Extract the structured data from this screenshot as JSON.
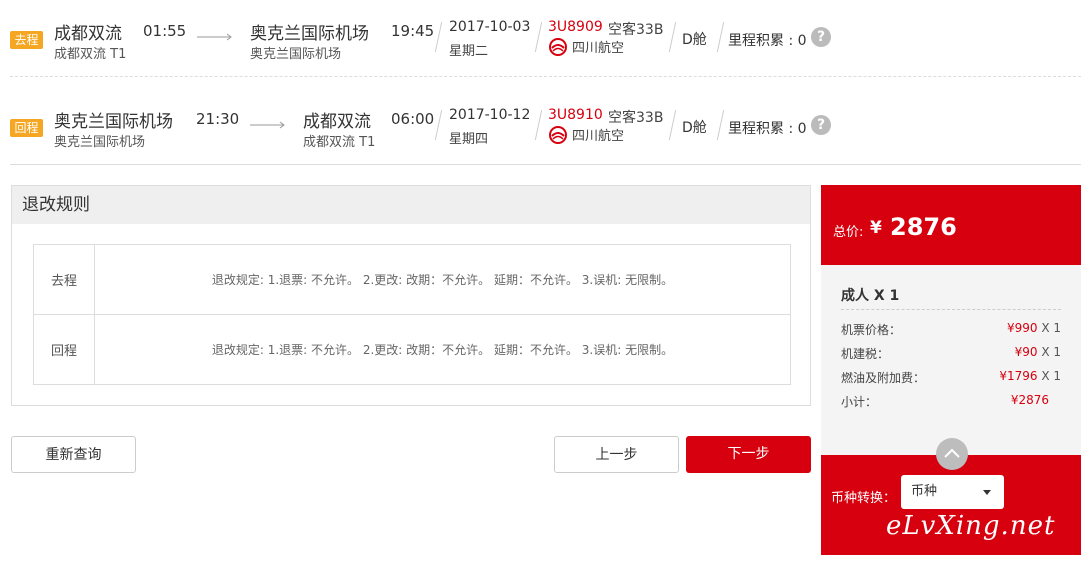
{
  "outbound": {
    "tag": "去程",
    "dep_city": "成都双流",
    "dep_time": "01:55",
    "dep_airport": "成都双流 T1",
    "arr_city": "奥克兰国际机场",
    "arr_time": "19:45",
    "arr_airport": "奥克兰国际机场",
    "date": "2017-10-03",
    "weekday": "星期二",
    "flight_no": "3U8909",
    "plane": "空客33B",
    "airline": "四川航空",
    "cabin": "D舱",
    "points": "里程积累 : 0"
  },
  "return": {
    "tag": "回程",
    "dep_city": "奥克兰国际机场",
    "dep_time": "21:30",
    "dep_airport": "奥克兰国际机场",
    "arr_city": "成都双流",
    "arr_time": "06:00",
    "arr_airport": "成都双流 T1",
    "date": "2017-10-12",
    "weekday": "星期四",
    "flight_no": "3U8910",
    "plane": "空客33B",
    "airline": "四川航空",
    "cabin": "D舱",
    "points": "里程积累 : 0"
  },
  "rules": {
    "title": "退改规则",
    "rows": [
      {
        "label": "去程",
        "text": "退改规定: 1.退票: 不允许。 2.更改: 改期：不允许。 延期：不允许。 3.误机: 无限制。"
      },
      {
        "label": "回程",
        "text": "退改规定: 1.退票: 不允许。 2.更改: 改期：不允许。 延期：不允许。 3.误机: 无限制。"
      }
    ]
  },
  "buttons": {
    "requery": "重新查询",
    "prev": "上一步",
    "next": "下一步"
  },
  "price": {
    "total_label": "总价:",
    "currency": "¥",
    "total": "2876",
    "adult": "成人 X 1",
    "lines": [
      {
        "label": "机票价格：",
        "value": "¥990",
        "mult": " X 1"
      },
      {
        "label": "机建税：",
        "value": "¥90",
        "mult": " X 1"
      },
      {
        "label": "燃油及附加费：",
        "value": "¥1796",
        "mult": " X 1"
      },
      {
        "label": "小计：",
        "value": "¥2876",
        "mult": ""
      }
    ],
    "currency_convert_label": "币种转换：",
    "currency_select": "币种",
    "watermark": "eLvXing.net"
  },
  "colors": {
    "accent": "#d7000f",
    "tag": "#f5a623"
  },
  "icons": [
    "arrow-right-icon",
    "question-icon",
    "sichuan-airlines-logo",
    "chevron-up-icon",
    "caret-down-icon"
  ]
}
